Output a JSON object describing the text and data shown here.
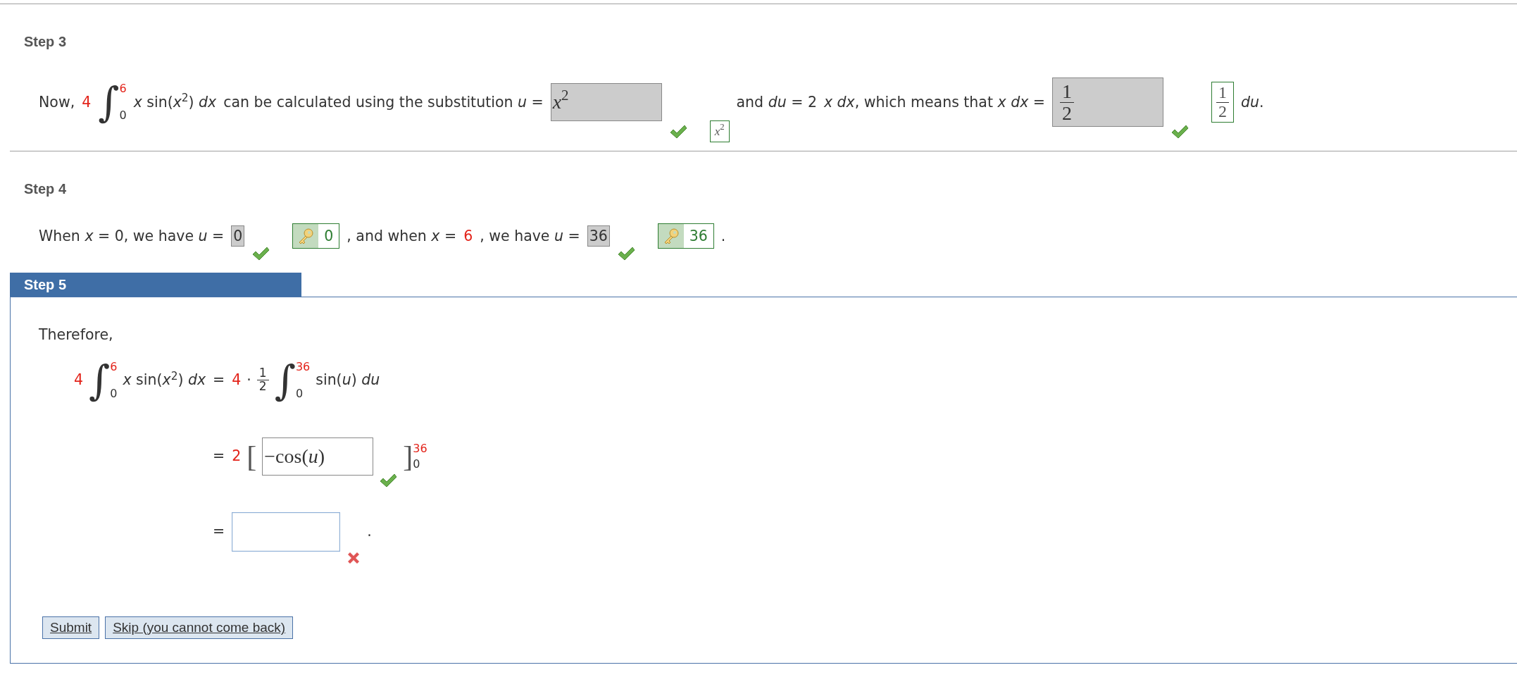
{
  "steps": [
    {
      "title": "Step 3",
      "active": false,
      "lines": [
        {
          "kind": "inline",
          "parts": [
            {
              "kind": "text",
              "text": "Now,"
            },
            {
              "kind": "given",
              "text": "4"
            },
            {
              "kind": "integral",
              "sign": "∫",
              "lower": "0",
              "upper": "6"
            },
            {
              "kind": "text",
              "text": "*x* sin(*x*$^{2}$) *dx*"
            },
            {
              "kind": "text",
              "text": "can be calculated using the substitution *u* ="
            },
            {
              "kind": "entry",
              "math": true,
              "locked": true,
              "value": "*x*$^{2}$",
              "correct": true
            },
            {
              "kind": "answer",
              "math": true,
              "key": false,
              "value": "*x*$^{2}$"
            },
            {
              "kind": "text",
              "text": "and *du* = 2"
            },
            {
              "kind": "text",
              "text": "*x dx*, which means that *x dx* ="
            },
            {
              "kind": "entry",
              "math": true,
              "locked": true,
              "fraction": [
                "1",
                "2"
              ],
              "correct": true
            },
            {
              "kind": "answer",
              "math": true,
              "key": false,
              "fraction": [
                "1",
                "2"
              ]
            },
            {
              "kind": "text",
              "text": "*du*."
            }
          ]
        }
      ]
    },
    {
      "title": "Step 4",
      "active": false,
      "lines": [
        {
          "kind": "inline",
          "parts": [
            {
              "kind": "text",
              "text": "When *x* = 0, we have *u* ="
            },
            {
              "kind": "entry",
              "math": false,
              "locked": true,
              "value": "0",
              "correct": true
            },
            {
              "kind": "answer",
              "math": false,
              "key": true,
              "value": "0"
            },
            {
              "kind": "text",
              "text": ", and when *x* ="
            },
            {
              "kind": "given",
              "text": "6"
            },
            {
              "kind": "text",
              "text": ", we have *u* ="
            },
            {
              "kind": "entry",
              "math": false,
              "locked": true,
              "value": "36",
              "correct": true
            },
            {
              "kind": "answer",
              "math": false,
              "key": true,
              "value": "36"
            },
            {
              "kind": "text",
              "text": "."
            }
          ]
        }
      ]
    },
    {
      "title": "Step 5",
      "active": true,
      "lines": [
        {
          "kind": "paragraph",
          "text": "Therefore,"
        },
        {
          "kind": "equations",
          "rows": [
            {
              "left": [
                {
                  "kind": "given",
                  "text": "4"
                },
                {
                  "kind": "integral",
                  "sign": "∫",
                  "lower": "0",
                  "upper": "6"
                },
                {
                  "kind": "text",
                  "text": "*x* sin(*x*$^{2}$) *dx*"
                }
              ],
              "sign": "=",
              "right": [
                {
                  "kind": "given",
                  "text": "4"
                },
                {
                  "kind": "text",
                  "text": "·"
                },
                {
                  "kind": "fraction",
                  "fraction": [
                    "1",
                    "2"
                  ]
                },
                {
                  "kind": "integral",
                  "sign": "∫",
                  "lower": "0",
                  "upper": "36"
                },
                {
                  "kind": "text",
                  "text": "sin(*u*) *du*"
                }
              ]
            },
            {
              "sign": "=",
              "right": [
                {
                  "kind": "given",
                  "text": "2"
                },
                {
                  "kind": "bracket",
                  "sign": "["
                },
                {
                  "kind": "entry",
                  "math": true,
                  "locked": false,
                  "value": "−cos(*u*)",
                  "correct": true
                },
                {
                  "kind": "limits",
                  "sign": "]",
                  "lower": "0",
                  "upper": "36"
                }
              ]
            },
            {
              "sign": "=",
              "right": [
                {
                  "kind": "input",
                  "focused": true,
                  "correct": false
                },
                {
                  "kind": "text",
                  "text": "."
                }
              ]
            }
          ]
        }
      ],
      "buttons": [
        "Submit",
        "Skip (you cannot come back)"
      ]
    }
  ]
}
